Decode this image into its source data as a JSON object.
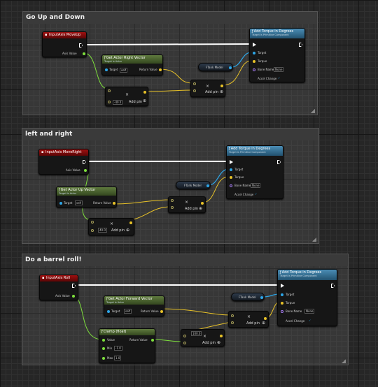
{
  "comments": [
    {
      "title": "Go Up and Down"
    },
    {
      "title": "left and right"
    },
    {
      "title": "Do a barrel roll!"
    }
  ],
  "common": {
    "axis_value": "Axis Value",
    "target": "Target",
    "torque": "Torque",
    "bone_name": "Bone Name",
    "bone_value": "None",
    "accel_change": "Accel Change",
    "return_value": "Return Value",
    "self": "self",
    "add_pin": "Add pin",
    "times": "×",
    "plus": "⊕",
    "add_torque_title": "Add Torque in Degrees",
    "add_torque_sub": "Target is Primitive Component",
    "target_actor": "Target is Actor",
    "ftank_model": "FTank Model"
  },
  "groups": [
    {
      "input": "InputAxis MoveUp",
      "getter": "Get Actor Right Vector",
      "multiplier": "-40.0"
    },
    {
      "input": "InputAxis MoveRight",
      "getter": "Get Actor Up Vector",
      "multiplier": "40.0"
    },
    {
      "input": "InputAxis Roll",
      "getter": "Get Actor Forward Vector",
      "multiplier": "100.0",
      "clamp": {
        "title": "Clamp (float)",
        "value": "Value",
        "min_label": "Min",
        "min": "-1.0",
        "max_label": "Max",
        "max": "1.0"
      }
    }
  ],
  "colors": {
    "exec": "#ffffff",
    "float": "#7ee03c",
    "vector": "#e8c228",
    "object": "#2da6e8"
  }
}
